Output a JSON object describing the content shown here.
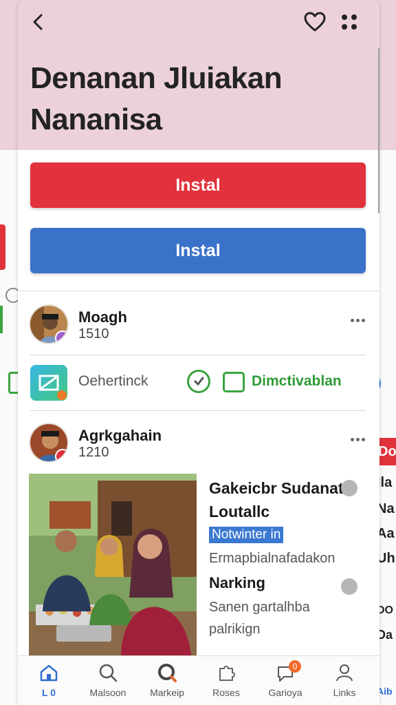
{
  "header": {
    "title_line1": "Denanan Jluiakan",
    "title_line2": "Nananisa"
  },
  "buttons": {
    "primary_label": "Instal",
    "secondary_label": "Instal"
  },
  "profile1": {
    "name": "Moagh",
    "count": "1510"
  },
  "app_row": {
    "label": "Oehertinck",
    "action_label": "Dimctivablan",
    "colors": {
      "green": "#3aa33e"
    }
  },
  "profile2": {
    "name": "Agrkgahain",
    "count": "1210"
  },
  "post": {
    "title": "Gakeicbr Sudanats Loutallc",
    "tag": "Notwinter in",
    "desc": "Ermapbialnafadakon",
    "subtitle": "Narking",
    "subdesc": "Sanen gartalhba palrikign"
  },
  "right_peek": {
    "tag": "Do",
    "lines": [
      "Ila",
      "Na",
      "Aa",
      "Uh",
      "DO",
      "Da"
    ]
  },
  "nav": [
    {
      "label": "L 0",
      "icon": "home-icon"
    },
    {
      "label": "Malsoon",
      "icon": "search-icon"
    },
    {
      "label": "Markeip",
      "icon": "search-outline-icon"
    },
    {
      "label": "Roses",
      "icon": "puzzle-icon"
    },
    {
      "label": "Garioya",
      "icon": "chat-icon",
      "badge": "0"
    },
    {
      "label": "Links",
      "icon": "person-icon"
    }
  ],
  "right_nav_peek": "Aib",
  "colors": {
    "header_bg": "#ecd2d8",
    "primary_red": "#e2323d",
    "primary_blue": "#3b72c9",
    "active_nav": "#2f6fd1"
  }
}
